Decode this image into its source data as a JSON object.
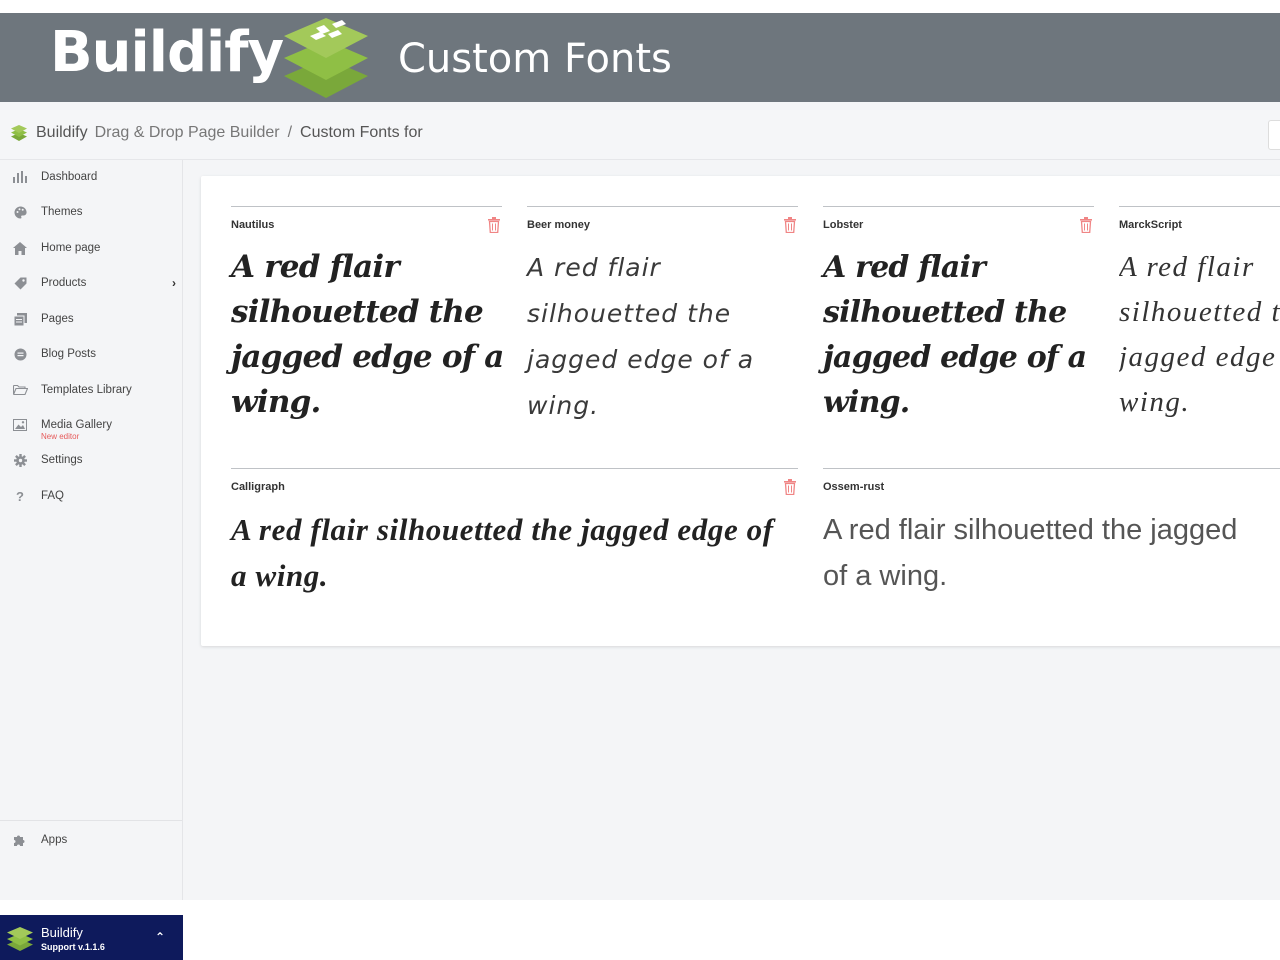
{
  "banner": {
    "brand": "Buildify",
    "subtitle": "Custom Fonts"
  },
  "breadcrumb": {
    "app": "Buildify",
    "parent": "Drag & Drop Page Builder",
    "separator": "/",
    "current": "Custom Fonts for"
  },
  "sidebar": {
    "items": [
      {
        "label": "Dashboard",
        "icon": "bar-chart-icon"
      },
      {
        "label": "Themes",
        "icon": "palette-icon"
      },
      {
        "label": "Home page",
        "icon": "home-icon"
      },
      {
        "label": "Products",
        "icon": "tag-icon"
      },
      {
        "label": "Pages",
        "icon": "pages-icon"
      },
      {
        "label": "Blog Posts",
        "icon": "comment-icon"
      },
      {
        "label": "Templates Library",
        "icon": "folder-open-icon"
      },
      {
        "label": "Media Gallery",
        "icon": "image-icon"
      },
      {
        "label": "Settings",
        "icon": "gear-icon"
      },
      {
        "label": "FAQ",
        "icon": "question-icon"
      }
    ],
    "media_badge": "New editor",
    "products_chevron": "›",
    "faq_glyph": "?",
    "apps_label": "Apps",
    "footer": {
      "title": "Buildify",
      "version": "Support v.1.1.6",
      "caret": "⌃"
    }
  },
  "fonts": [
    {
      "name": "Nautilus",
      "sample": "A red flair silhouetted the jagged edge of a wing."
    },
    {
      "name": "Beer money",
      "sample": "A red flair silhouetted the jagged edge of a wing."
    },
    {
      "name": "Lobster",
      "sample": "A red flair silhouetted the jagged edge of a wing."
    },
    {
      "name": "MarckScript",
      "sample_lines": [
        "A red flair",
        "silhouetted t",
        "jagged edge",
        "wing."
      ]
    },
    {
      "name": "Calligraph",
      "sample": "A red flair silhouetted the jagged edge of a wing."
    },
    {
      "name": "Ossem-rust",
      "sample_lines": [
        "A red flair silhouetted the jagged",
        "of a wing."
      ]
    }
  ],
  "colors": {
    "banner": "#6e767d",
    "logo_light": "#a3c95a",
    "logo_dark": "#7aa83a",
    "delete_icon": "#f08585",
    "footer": "#0e1a5c",
    "badge": "#e65a5a"
  }
}
